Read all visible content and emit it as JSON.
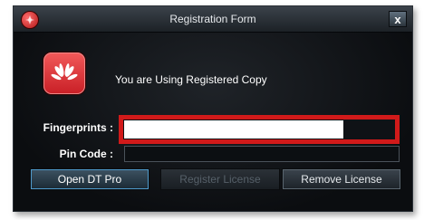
{
  "window": {
    "title": "Registration Form",
    "close_label": "x"
  },
  "status": {
    "message": "You are Using Registered Copy"
  },
  "form": {
    "fingerprints_label": "Fingerprints :",
    "fingerprints_value": "",
    "pin_label": "Pin Code :",
    "pin_value": ""
  },
  "buttons": {
    "open": "Open DT Pro",
    "register": "Register License",
    "remove": "Remove License"
  },
  "colors": {
    "highlight": "#d11a1a",
    "logo": "#e0323a",
    "primary_focus": "#4f9acb"
  },
  "icons": {
    "app": "app-logo-icon",
    "brand": "huawei-logo-icon",
    "close": "close-icon"
  }
}
